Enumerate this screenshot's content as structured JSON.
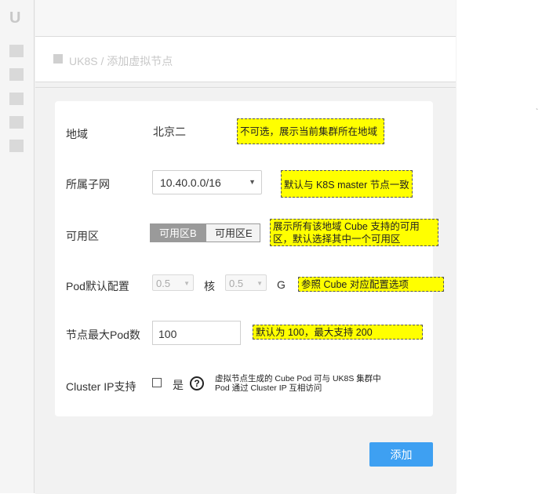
{
  "sidebar": {
    "logo": "U",
    "icons": [
      "nav-icon-1",
      "nav-icon-2",
      "nav-icon-3",
      "nav-icon-4",
      "nav-icon-5"
    ]
  },
  "breadcrumb": {
    "text": "UK8S / 添加虚拟节点"
  },
  "form": {
    "region": {
      "label": "地域",
      "value": "北京二"
    },
    "subnet": {
      "label": "所属子网",
      "value": "10.40.0.0/16"
    },
    "zone": {
      "label": "可用区",
      "options": [
        "可用区B",
        "可用区E"
      ],
      "selected": "可用区B"
    },
    "pod_config": {
      "label": "Pod默认配置",
      "cpu_value": "0.5",
      "cpu_unit": "核",
      "mem_value": "0.5",
      "mem_unit": "G"
    },
    "max_pods": {
      "label": "节点最大Pod数",
      "value": "100"
    },
    "cluster_ip": {
      "label": "Cluster IP支持",
      "checkbox_label": "是",
      "help_glyph": "?",
      "note_line1": "虚拟节点生成的 Cube Pod 可与 UK8S 集群中",
      "note_line2": "Pod 通过 Cluster IP 互相访问"
    }
  },
  "annotations": {
    "region": "不可选，展示当前集群所在地域",
    "subnet": "默认与 K8S master 节点一致",
    "zone_line1": "展示所有该地域 Cube 支持的可用",
    "zone_line2": "区，默认选择其中一个可用区",
    "pod_config": "参照 Cube 对应配置选项",
    "max_pods": "默认为 100，最大支持 200"
  },
  "actions": {
    "add_label": "添加"
  },
  "colors": {
    "primary": "#3ea0f2",
    "annotation": "#ffff00",
    "segment_active": "#9a9a9a"
  }
}
